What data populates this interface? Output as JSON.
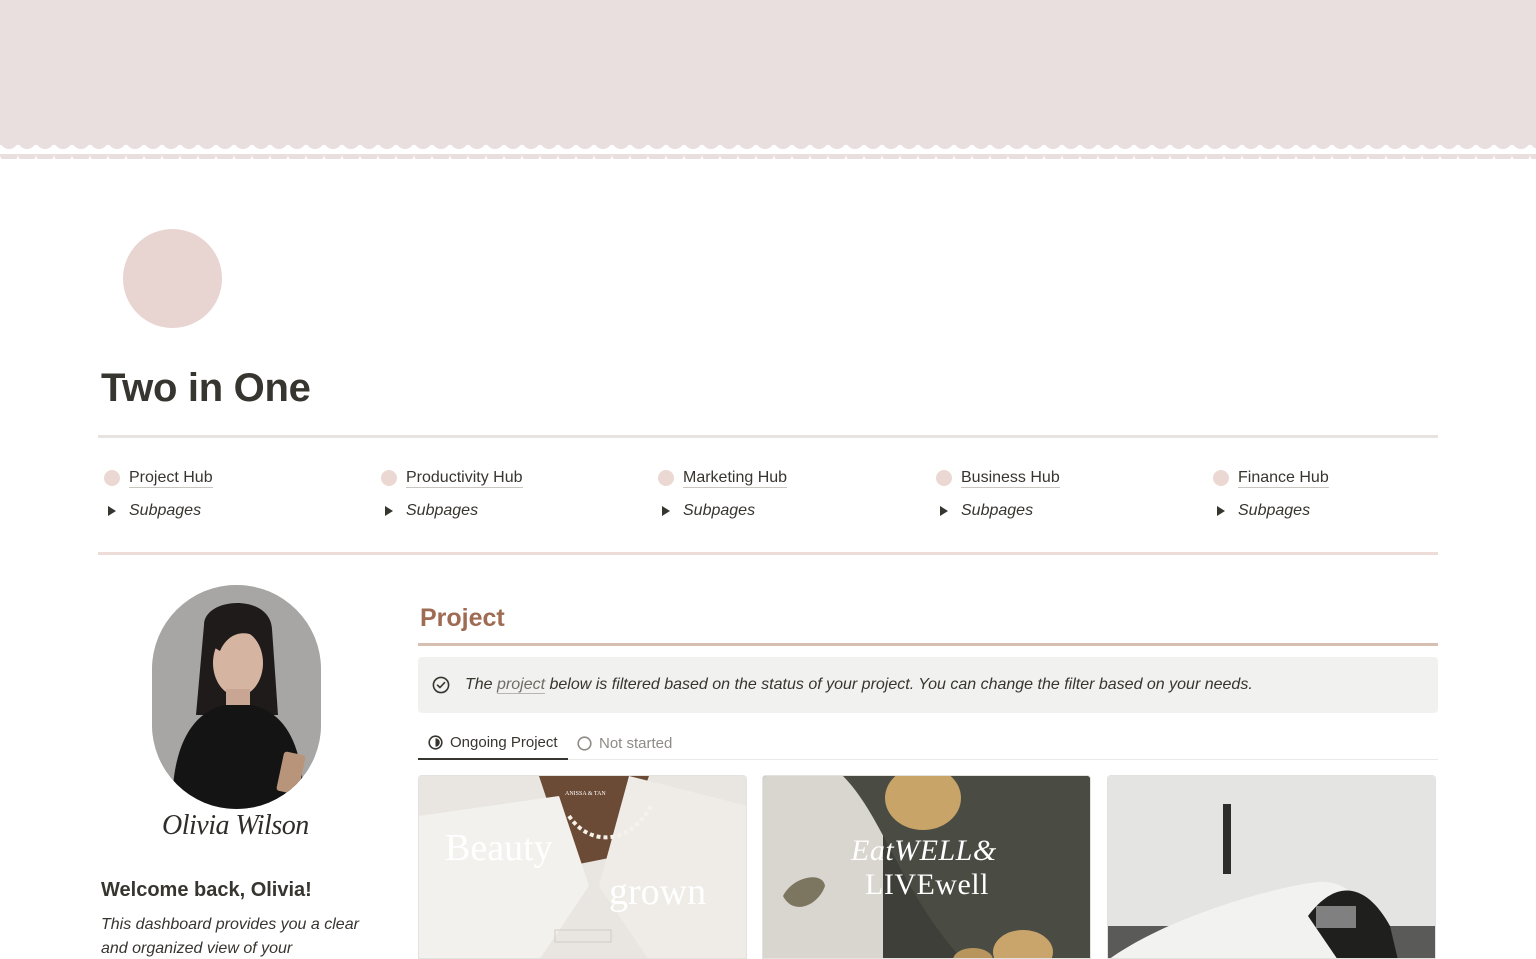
{
  "page": {
    "title": "Two in One",
    "cover_color": "#e8dfde",
    "icon_color": "#e8d4d0"
  },
  "hubs": [
    {
      "label": "Project Hub",
      "toggle": "Subpages"
    },
    {
      "label": "Productivity Hub",
      "toggle": "Subpages"
    },
    {
      "label": "Marketing Hub",
      "toggle": "Subpages"
    },
    {
      "label": "Business Hub",
      "toggle": "Subpages"
    },
    {
      "label": "Finance Hub",
      "toggle": "Subpages"
    }
  ],
  "profile": {
    "signature": "Olivia Wilson",
    "welcome": "Welcome back, Olivia!",
    "intro": "This dashboard provides you a clear and organized view of your"
  },
  "project": {
    "title": "Project",
    "title_color": "#9f6b53",
    "callout": {
      "icon": "check-circle-icon",
      "prefix": "The ",
      "link": "project",
      "suffix": " below is filtered based on the status of your project. You can change the filter based on your needs."
    },
    "tabs": [
      {
        "label": "Ongoing Project",
        "icon": "half-circle-icon",
        "active": true
      },
      {
        "label": "Not started",
        "icon": "empty-circle-icon",
        "active": false
      }
    ],
    "cards": [
      {
        "line1": "Beauty",
        "line2": "grown",
        "small": "ANISSA & TAN"
      },
      {
        "line1": "EatWELL&",
        "line2": "LIVEwell"
      },
      {
        "line1": ""
      }
    ]
  }
}
